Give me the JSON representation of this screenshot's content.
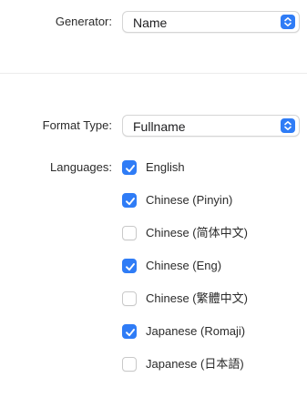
{
  "generator": {
    "label": "Generator:",
    "value": "Name"
  },
  "format_type": {
    "label": "Format Type:",
    "value": "Fullname"
  },
  "languages": {
    "label": "Languages:",
    "items": [
      {
        "label": "English",
        "checked": true
      },
      {
        "label": "Chinese (Pinyin)",
        "checked": true
      },
      {
        "label": "Chinese (简体中文)",
        "checked": false
      },
      {
        "label": "Chinese (Eng)",
        "checked": true
      },
      {
        "label": "Chinese (繁體中文)",
        "checked": false
      },
      {
        "label": "Japanese (Romaji)",
        "checked": true
      },
      {
        "label": "Japanese (日本語)",
        "checked": false
      }
    ]
  },
  "colors": {
    "accent": "#2f7cf6",
    "divider": "#ececec"
  }
}
